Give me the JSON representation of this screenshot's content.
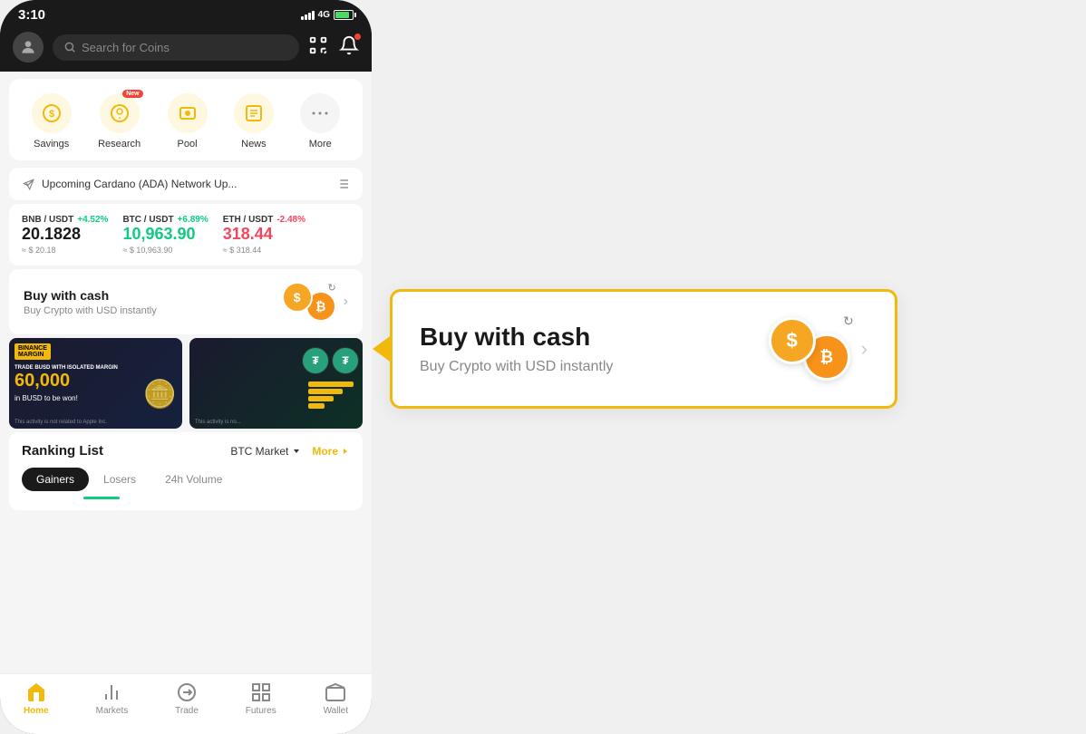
{
  "statusBar": {
    "time": "3:10",
    "network": "4G",
    "batteryLevel": "85%"
  },
  "topBar": {
    "searchPlaceholder": "Search for Coins"
  },
  "quickLinks": [
    {
      "id": "savings",
      "label": "Savings",
      "icon": "savings-icon",
      "hasNew": false
    },
    {
      "id": "research",
      "label": "Research",
      "icon": "research-icon",
      "hasNew": true
    },
    {
      "id": "pool",
      "label": "Pool",
      "icon": "pool-icon",
      "hasNew": false
    },
    {
      "id": "news",
      "label": "News",
      "icon": "news-icon",
      "hasNew": false
    },
    {
      "id": "more",
      "label": "More",
      "icon": "more-icon",
      "hasNew": false
    }
  ],
  "announcement": {
    "text": "Upcoming Cardano (ADA) Network Up..."
  },
  "tickers": [
    {
      "pair": "BNB / USDT",
      "change": "+4.52%",
      "price": "20.1828",
      "usd": "≈ $ 20.18",
      "positive": true
    },
    {
      "pair": "BTC / USDT",
      "change": "+6.89%",
      "price": "10,963.90",
      "usd": "≈ $ 10,963.90",
      "positive": true
    },
    {
      "pair": "ETH / USDT",
      "change": "-2.48%",
      "price": "318.44",
      "usd": "≈ $ 318.44",
      "positive": false
    }
  ],
  "buyCash": {
    "title": "Buy with cash",
    "subtitle": "Buy Crypto with USD instantly"
  },
  "banner1": {
    "brand": "BINANCE",
    "brandSub": "MARGIN",
    "tradeText": "TRADE BUSD WITH ISOLATED MARGIN",
    "amount": "60,000",
    "unit": "in BUSD to be won!",
    "disclaimer": "This activity is not related to Apple Inc."
  },
  "banner2": {
    "disclaimer": "This activity is no..."
  },
  "rankingList": {
    "title": "Ranking List",
    "market": "BTC Market",
    "moreLabel": "More",
    "tabs": [
      {
        "id": "gainers",
        "label": "Gainers",
        "active": true
      },
      {
        "id": "losers",
        "label": "Losers",
        "active": false
      },
      {
        "id": "volume",
        "label": "24h Volume",
        "active": false
      }
    ]
  },
  "bottomNav": [
    {
      "id": "home",
      "label": "Home",
      "icon": "home-icon",
      "active": true
    },
    {
      "id": "markets",
      "label": "Markets",
      "icon": "markets-icon",
      "active": false
    },
    {
      "id": "trade",
      "label": "Trade",
      "icon": "trade-icon",
      "active": false
    },
    {
      "id": "futures",
      "label": "Futures",
      "icon": "futures-icon",
      "active": false
    },
    {
      "id": "wallet",
      "label": "Wallet",
      "icon": "wallet-icon",
      "active": false
    }
  ],
  "popup": {
    "title": "Buy with cash",
    "subtitle": "Buy Crypto with USD instantly"
  },
  "colors": {
    "accent": "#f0b90b",
    "positive": "#0ecb81",
    "negative": "#f6465d",
    "dark": "#1a1a1a"
  }
}
